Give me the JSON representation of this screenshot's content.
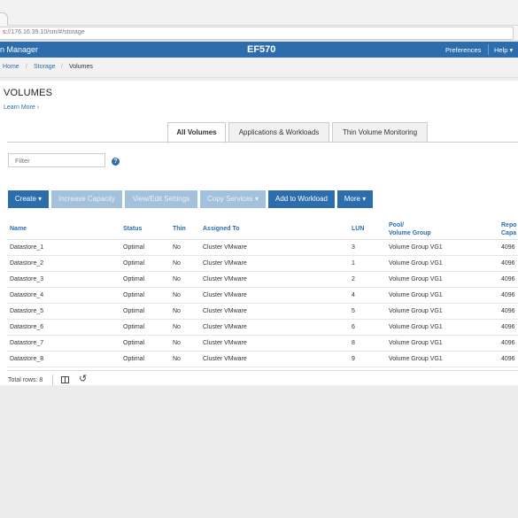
{
  "browser": {
    "url_scheme": "s",
    "url_rest": "://176.16.39.10/sm/#/storage"
  },
  "appbar": {
    "brand": "n Manager",
    "device": "EF570",
    "preferences": "Preferences",
    "help": "Help ▾"
  },
  "breadcrumb": [
    "Home",
    "Storage",
    "Volumes"
  ],
  "page": {
    "title": "VOLUMES",
    "learn_more": "Learn More ›"
  },
  "tabs": [
    {
      "label": "All Volumes",
      "active": true
    },
    {
      "label": "Applications & Workloads",
      "active": false
    },
    {
      "label": "Thin Volume Monitoring",
      "active": false
    }
  ],
  "filter": {
    "placeholder": "Filter",
    "help_icon": "question-circle-icon"
  },
  "toolbar": {
    "create": "Create ▾",
    "increase": "Increase Capacity",
    "view_edit": "View/Edit Settings",
    "copy_services": "Copy Services ▾",
    "add_workload": "Add to Workload",
    "more": "More ▾"
  },
  "table": {
    "headers": {
      "name": "Name",
      "status": "Status",
      "thin": "Thin",
      "assigned": "Assigned To",
      "lun": "LUN",
      "pool_1": "Pool/",
      "pool_2": "Volume Group",
      "cap_1": "Repo",
      "cap_2": "Capa"
    },
    "rows": [
      [
        "Datastore_1",
        "Optimal",
        "No",
        "Cluster VMware",
        "3",
        "Volume Group VG1",
        "4096"
      ],
      [
        "Datastore_2",
        "Optimal",
        "No",
        "Cluster VMware",
        "1",
        "Volume Group VG1",
        "4096"
      ],
      [
        "Datastore_3",
        "Optimal",
        "No",
        "Cluster VMware",
        "2",
        "Volume Group VG1",
        "4096"
      ],
      [
        "Datastore_4",
        "Optimal",
        "No",
        "Cluster VMware",
        "4",
        "Volume Group VG1",
        "4096"
      ],
      [
        "Datastore_5",
        "Optimal",
        "No",
        "Cluster VMware",
        "5",
        "Volume Group VG1",
        "4096"
      ],
      [
        "Datastore_6",
        "Optimal",
        "No",
        "Cluster VMware",
        "6",
        "Volume Group VG1",
        "4096"
      ],
      [
        "Datastore_7",
        "Optimal",
        "No",
        "Cluster VMware",
        "8",
        "Volume Group VG1",
        "4096"
      ],
      [
        "Datastore_8",
        "Optimal",
        "No",
        "Cluster VMware",
        "9",
        "Volume Group VG1",
        "4096"
      ]
    ],
    "total_rows": "Total rows: 8"
  },
  "colors": {
    "accent": "#2b6dad",
    "disabled": "#a3c0dc"
  }
}
